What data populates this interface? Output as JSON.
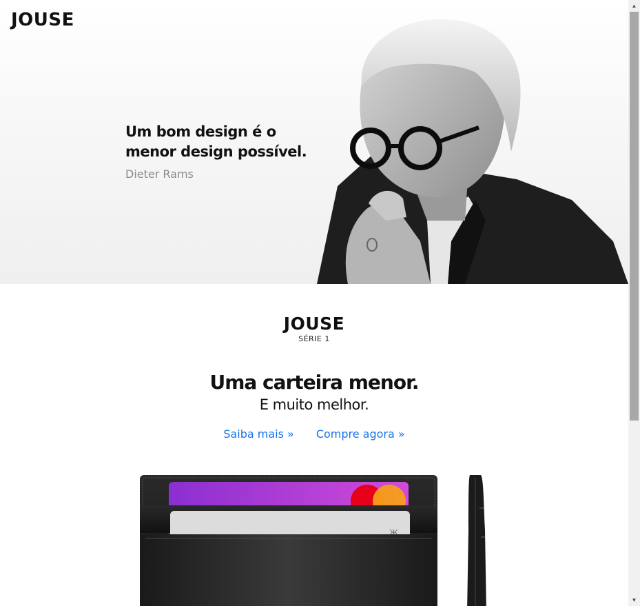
{
  "header": {
    "brand": "JOUSE"
  },
  "hero": {
    "quote_line1": "Um bom design é o",
    "quote_line2": "menor design possível.",
    "author": "Dieter Rams"
  },
  "product": {
    "logo": "JOUSE",
    "series": "SÉRIE 1",
    "headline": "Uma carteira menor.",
    "subline": "E muito melhor.",
    "link_learn": "Saiba mais »",
    "link_buy": "Compre agora »"
  },
  "colors": {
    "link": "#1a73e8",
    "text": "#111111",
    "muted": "#8a8a8a"
  }
}
